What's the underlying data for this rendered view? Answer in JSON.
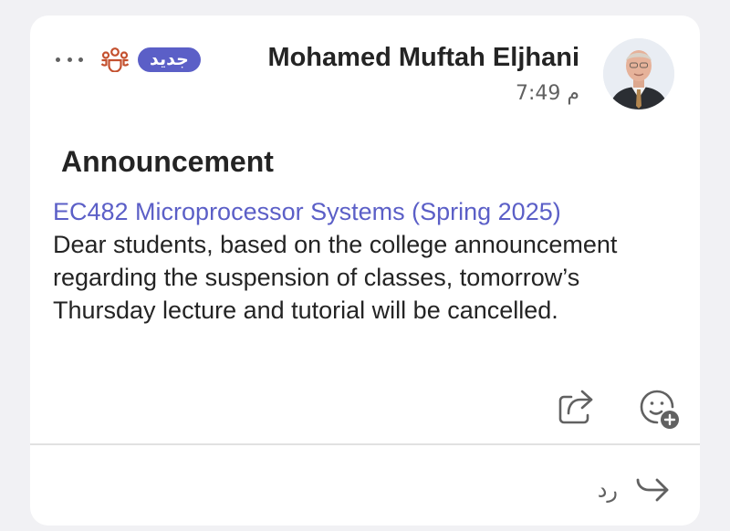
{
  "header": {
    "new_badge": "جديد",
    "author_name": "Mohamed Muftah Eljhani",
    "timestamp": "7:49 م"
  },
  "post": {
    "subject": "Announcement",
    "channel_link": "EC482 Microprocessor Systems (Spring 2025)",
    "message": "Dear students, based on the college announcement regarding the suspension of classes, tomorrow’s Thursday lecture and tutorial will be cancelled."
  },
  "footer": {
    "reply_label": "رد"
  },
  "colors": {
    "accent": "#5b5fc7",
    "team_icon": "#c4512f",
    "text_primary": "#242424",
    "text_secondary": "#616161",
    "card_background": "#ffffff",
    "page_background": "#f1f1f4"
  },
  "icons": {
    "more": "more-options-icon",
    "team": "team-icon",
    "share": "share-icon",
    "react": "add-reaction-icon",
    "reply": "reply-arrow-icon"
  }
}
